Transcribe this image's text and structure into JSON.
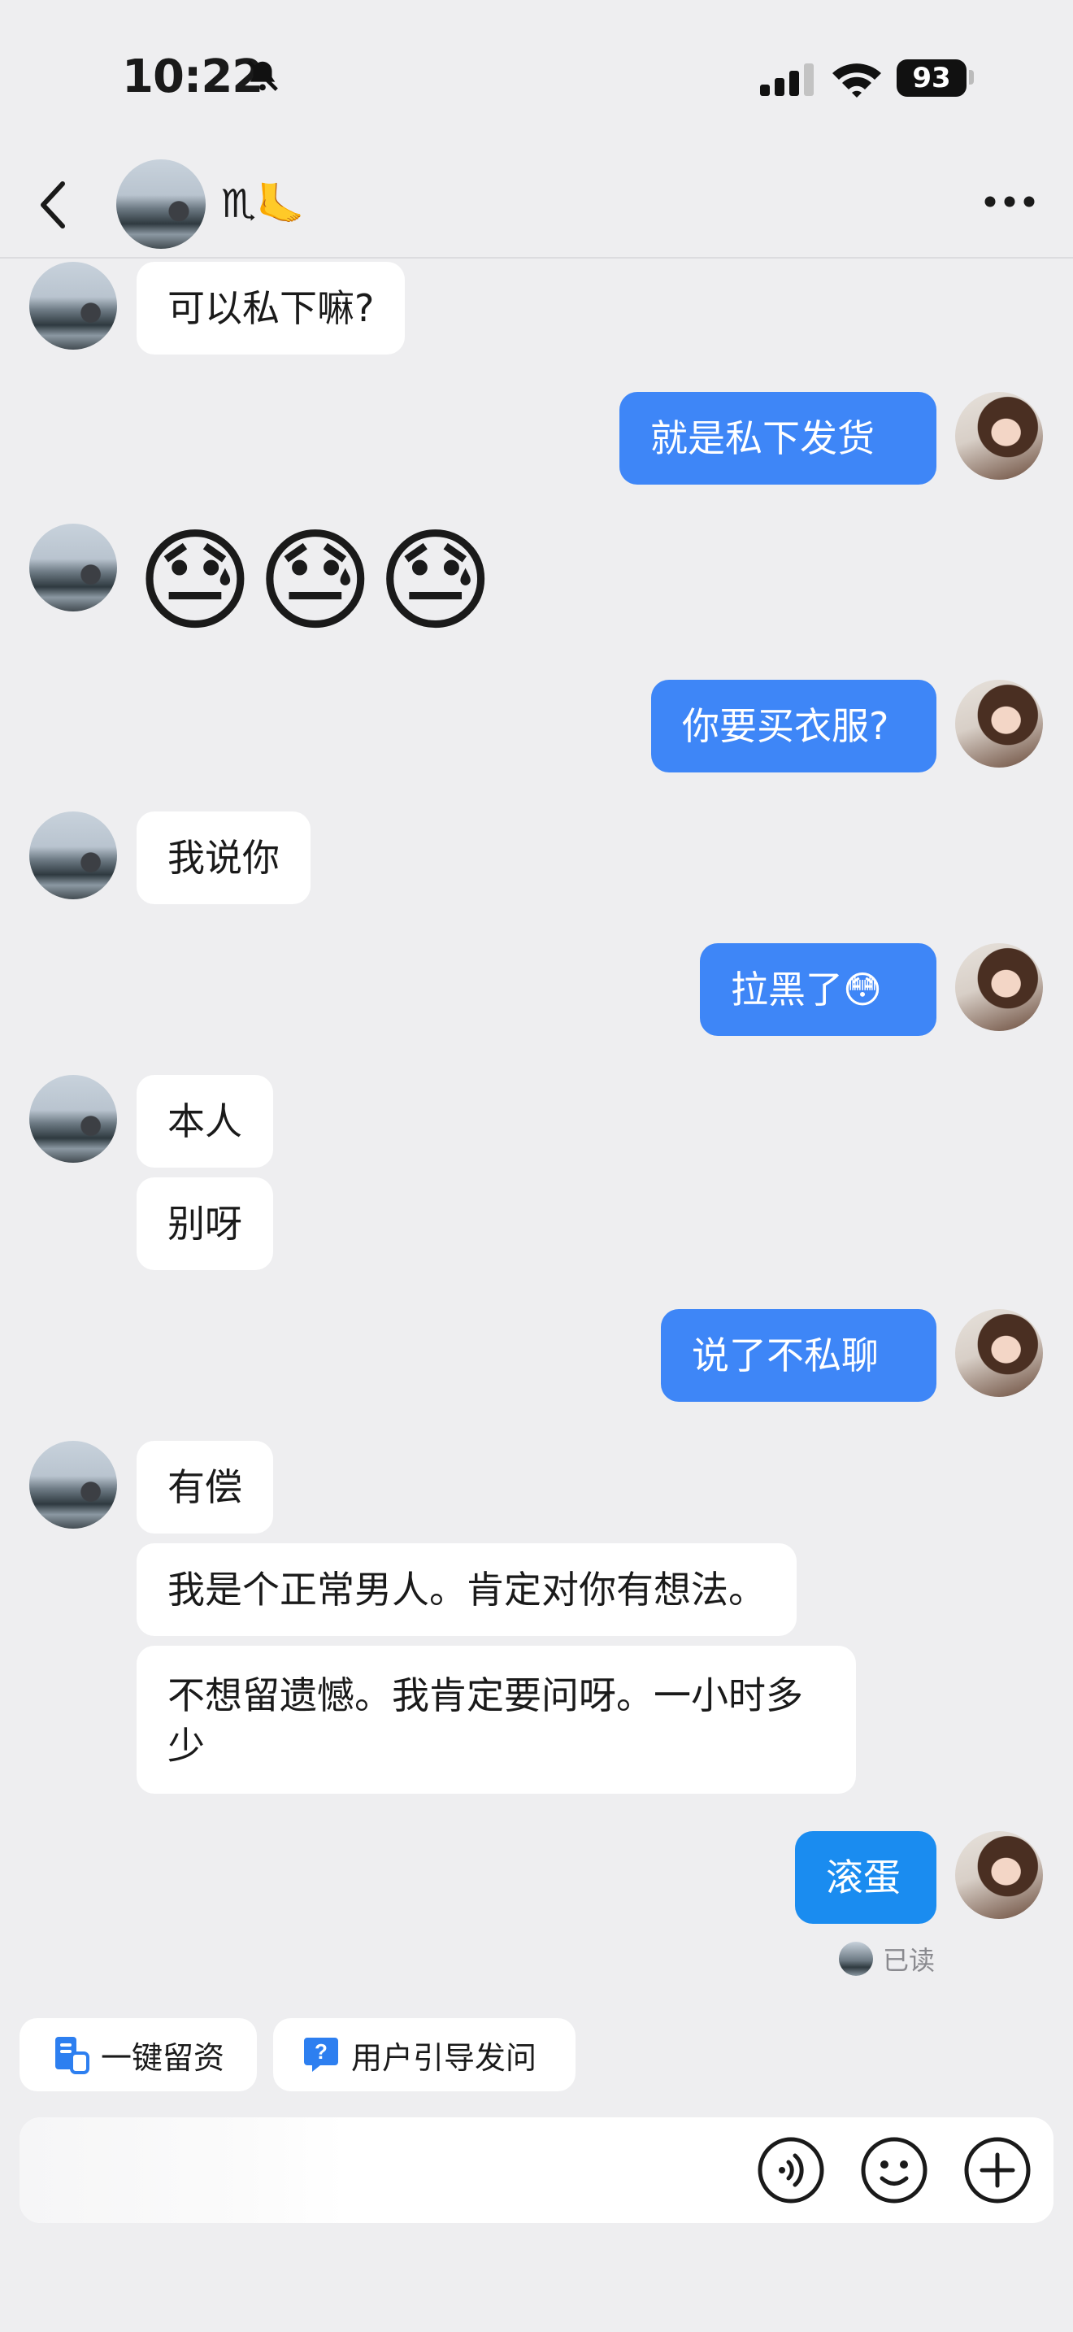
{
  "status_bar": {
    "time": "10:22",
    "battery": "93"
  },
  "header": {
    "contact_name": "♏🦶"
  },
  "messages": [
    {
      "side": "in",
      "text": "可以私下嘛?"
    },
    {
      "side": "out",
      "text": "就是私下发货"
    },
    {
      "side": "in",
      "text": "😓😓😓"
    },
    {
      "side": "out",
      "text": "你要买衣服?"
    },
    {
      "side": "in",
      "text": "我说你"
    },
    {
      "side": "out",
      "text": "拉黑了😳"
    },
    {
      "side": "in",
      "text": "本人"
    },
    {
      "side": "in",
      "text": "别呀"
    },
    {
      "side": "out",
      "text": "说了不私聊"
    },
    {
      "side": "in",
      "text": "有偿"
    },
    {
      "side": "in",
      "text": "我是个正常男人。肯定对你有想法。"
    },
    {
      "side": "in",
      "text": "不想留遗憾。我肯定要问呀。一小时多少"
    },
    {
      "side": "out",
      "text": "滚蛋"
    }
  ],
  "read_receipt": "已读",
  "quick_actions": [
    {
      "label": "一键留资",
      "icon": "lead-form-icon"
    },
    {
      "label": "用户引导发问",
      "icon": "question-icon"
    }
  ],
  "input_bar": {
    "icons": [
      "voice-icon",
      "emoji-icon",
      "plus-icon"
    ]
  },
  "colors": {
    "outgoing_bubble": "#3e86f7",
    "incoming_bubble": "#ffffff",
    "background": "#eeeef0"
  }
}
